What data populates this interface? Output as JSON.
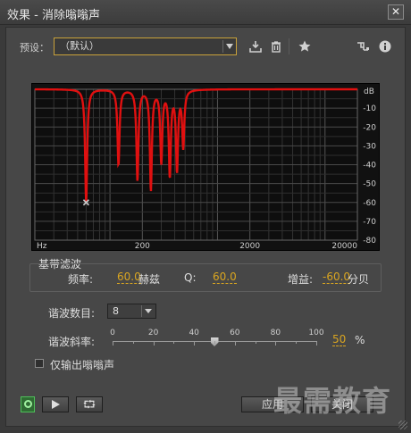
{
  "window": {
    "title": "效果 - 消除嗡嗡声",
    "close_glyph": "✕"
  },
  "preset": {
    "label": "预设：",
    "value": "（默认）"
  },
  "toolbar": {
    "save_icon": "download-icon",
    "delete_icon": "trash-icon",
    "favorite_icon": "star-icon",
    "routing_icon": "routing-icon",
    "info_icon": "info-icon"
  },
  "graph": {
    "db_label": "dB",
    "y_ticks": [
      "-10",
      "-20",
      "-30",
      "-40",
      "-50",
      "-60",
      "-70",
      "-80"
    ],
    "x_ticks": [
      "Hz",
      "200",
      "2000",
      "20000"
    ]
  },
  "chart_data": {
    "type": "line",
    "x_scale": "log",
    "xlabel": "Hz",
    "ylabel": "dB",
    "xlim": [
      20,
      20000
    ],
    "ylim": [
      -80,
      0
    ],
    "series": [
      {
        "notch_frequencies_hz": [
          60,
          120,
          180,
          240,
          300,
          360,
          420,
          480
        ],
        "notch_depths_db": [
          -60,
          -40,
          -48,
          -53,
          -38,
          -45,
          -42,
          -30
        ]
      }
    ],
    "grid": true
  },
  "base_filter": {
    "title": "基带滤波",
    "freq_label": "频率:",
    "freq_value": "60.0",
    "freq_unit": "赫兹",
    "q_label": "Q:",
    "q_value": "60.0",
    "gain_label": "增益:",
    "gain_value": "-60.0",
    "gain_unit": "分贝"
  },
  "harmonics": {
    "label": "谐波数目:",
    "value": "8"
  },
  "slope": {
    "label": "谐波斜率:",
    "ticks": [
      "0",
      "20",
      "40",
      "60",
      "80",
      "100"
    ],
    "value": "50",
    "unit": "%",
    "level_percent": 50
  },
  "output_only": {
    "label": "仅输出嗡嗡声",
    "checked": false
  },
  "buttons": {
    "apply": "应用",
    "close": "关闭"
  },
  "watermark": "最需教育",
  "colors": {
    "accent": "#d9a520",
    "curve": "#e01010",
    "power": "#4fbf5a"
  }
}
